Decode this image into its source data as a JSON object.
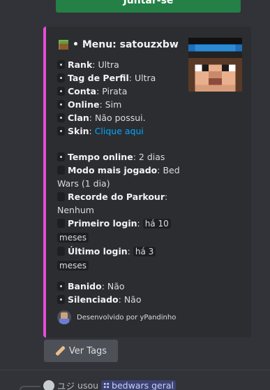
{
  "top_button": {
    "label": "Juntar-se"
  },
  "embed": {
    "accent_color": "#e94bd6",
    "title": "• Menu: satouzxbw",
    "fields": [
      {
        "key": "Rank",
        "value": "Ultra"
      },
      {
        "key": "Tag de Perfil",
        "value": "Ultra"
      },
      {
        "key": "Conta",
        "value": "Pirata"
      },
      {
        "key": "Online",
        "value": "Sim"
      },
      {
        "key": "Clan",
        "value": "Não possui."
      },
      {
        "key": "Skin",
        "value": "Clique aqui"
      }
    ],
    "stats": {
      "tempo_online": {
        "key": "Tempo online",
        "value": "2 dias"
      },
      "modo_mais_jogado": {
        "key": "Modo mais jogado",
        "value": "Bed Wars (1 dia)"
      },
      "recorde_parkour": {
        "key": "Recorde do Parkour",
        "value": "Nenhum"
      },
      "primeiro_login": {
        "key": "Primeiro login",
        "value_a": "há 10",
        "value_b": "meses"
      },
      "ultimo_login": {
        "key": "Último login",
        "value_a": "há 3",
        "value_b": "meses"
      }
    },
    "flags": [
      {
        "key": "Banido",
        "value": "Não"
      },
      {
        "key": "Silenciado",
        "value": "Não"
      }
    ],
    "footer": "Desenvolvido por yPandinho"
  },
  "tags_button": {
    "label": "Ver Tags",
    "icon": "bandage-icon"
  },
  "reply": {
    "user": "ユジ",
    "action": "usou",
    "channel": "bedwars geral"
  }
}
